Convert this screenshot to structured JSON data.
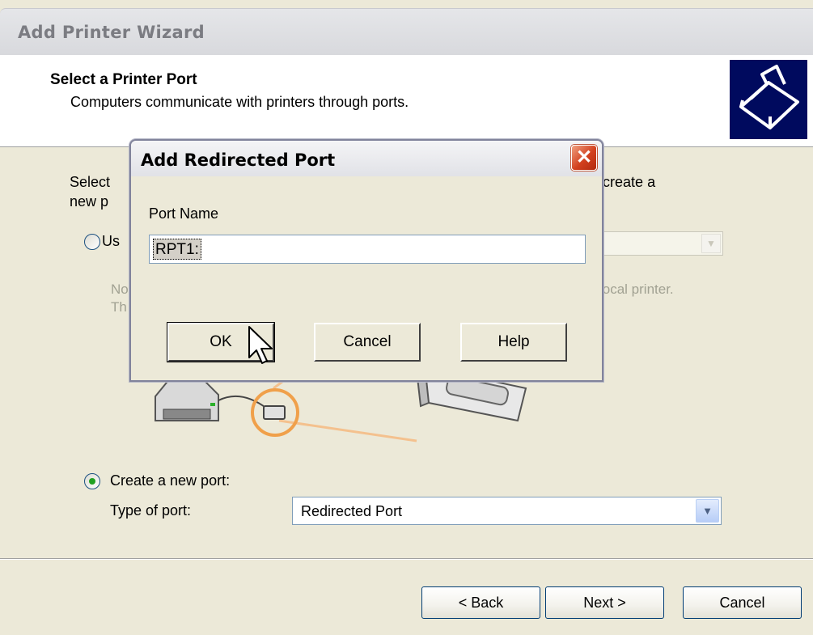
{
  "wizard": {
    "title": "Add Printer Wizard",
    "header_title": "Select a Printer Port",
    "header_subtitle": "Computers communicate with printers through ports.",
    "intro_line1": "Select",
    "intro_line1_end": "ou can create a",
    "intro_line2": "new p",
    "use_port_label": "Us",
    "note_line1_start": "No",
    "note_line1_end": "local printer.",
    "note_line2_start": "Th",
    "create_port_label": "Create a new port:",
    "type_of_port_label": "Type of port:",
    "type_of_port_value": "Redirected Port",
    "back_button": "< Back",
    "next_button": "Next >",
    "cancel_button": "Cancel"
  },
  "dialog": {
    "title": "Add Redirected Port",
    "port_name_label": "Port Name",
    "port_name_value": "RPT1:",
    "ok_button": "OK",
    "cancel_button": "Cancel",
    "help_button": "Help"
  },
  "colors": {
    "window_bg": "#ece9d8",
    "accent_blue": "#003c74",
    "close_red": "#d2401e",
    "radio_green": "#21a121"
  }
}
